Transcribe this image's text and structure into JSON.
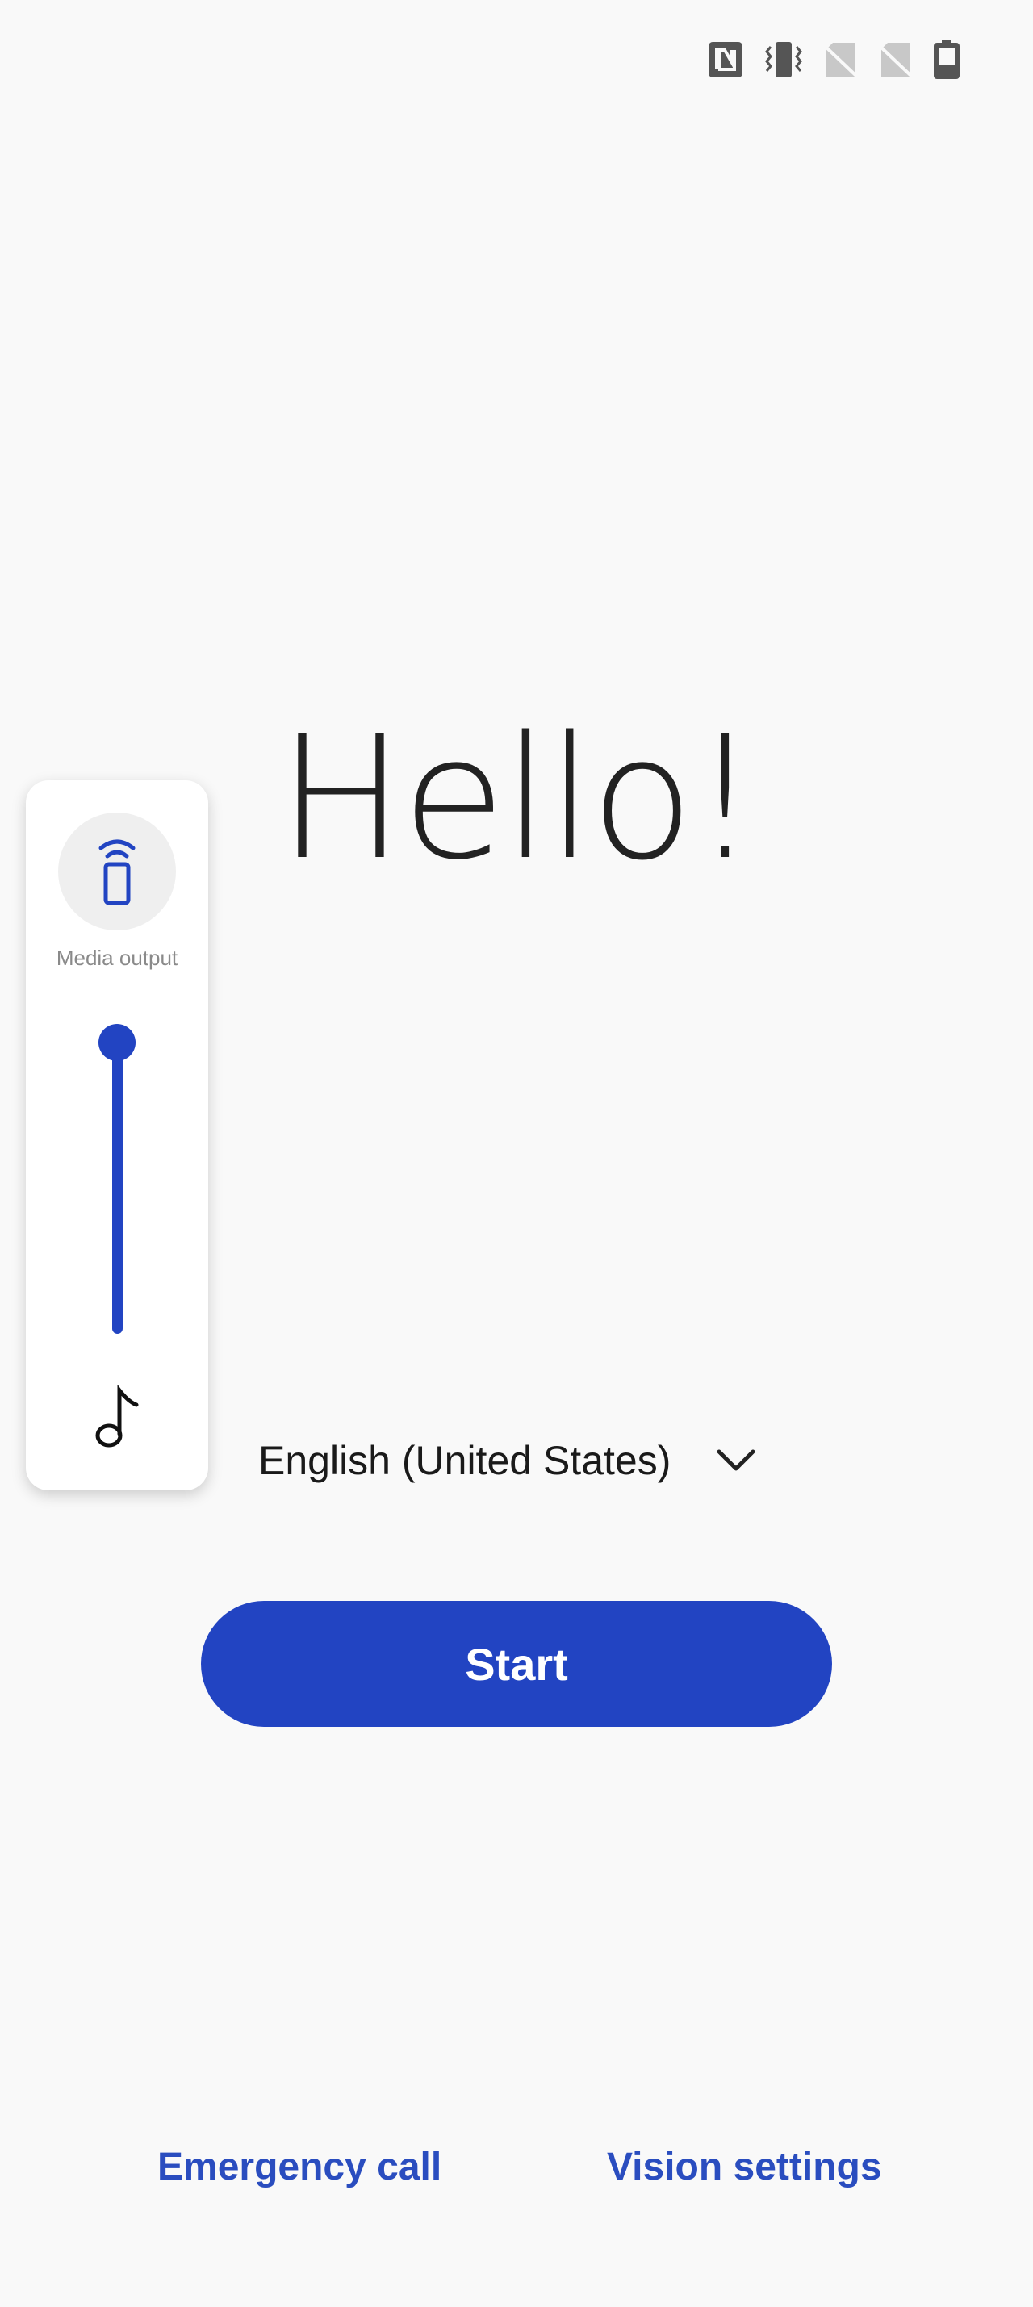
{
  "status_bar": {
    "icons": [
      "nfc-icon",
      "vibrate-icon",
      "no-sim-icon",
      "no-sim-icon",
      "battery-icon"
    ]
  },
  "greeting": "Hello!",
  "volume_panel": {
    "media_output_label": "Media output",
    "volume_level_fraction": 1.0,
    "stream_icon": "music-note-icon"
  },
  "language": {
    "selected": "English (United States)"
  },
  "start_label": "Start",
  "bottom_links": {
    "emergency_call": "Emergency call",
    "vision_settings": "Vision settings"
  },
  "colors": {
    "accent": "#2244c2",
    "link": "#2a4dbf",
    "background": "#f9f9f9"
  }
}
